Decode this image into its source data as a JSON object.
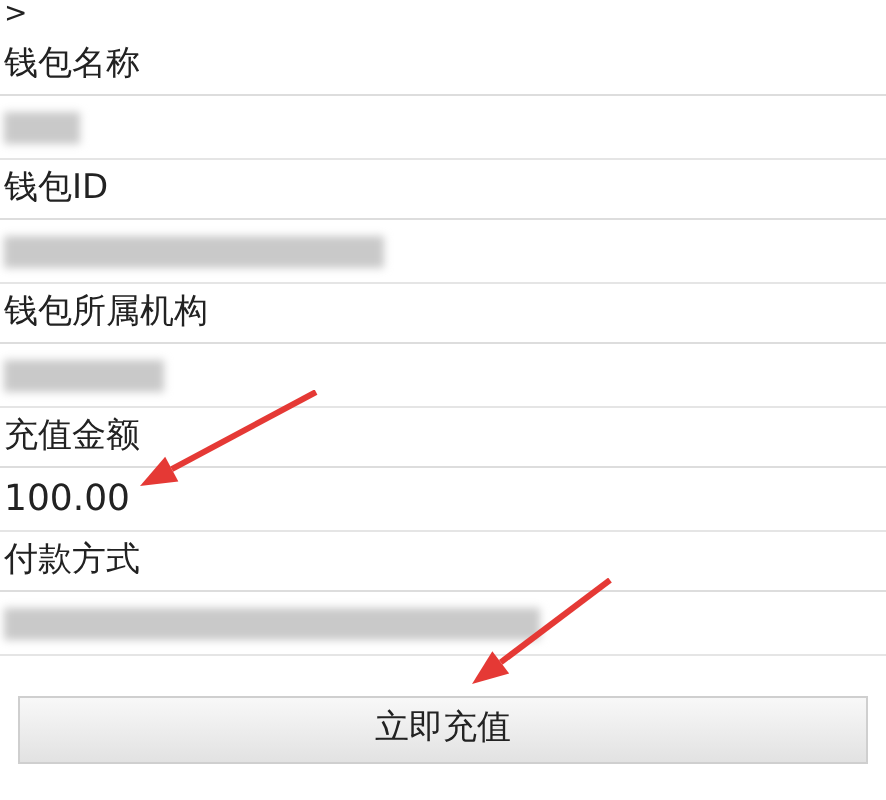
{
  "back": ">",
  "fields": [
    {
      "label": "钱包名称",
      "kind": "redacted"
    },
    {
      "label": "钱包ID",
      "kind": "redacted"
    },
    {
      "label": "钱包所属机构",
      "kind": "redacted"
    },
    {
      "label": "充值金额",
      "kind": "value",
      "value": "100.00"
    },
    {
      "label": "付款方式",
      "kind": "redacted"
    }
  ],
  "button": "立即充值"
}
